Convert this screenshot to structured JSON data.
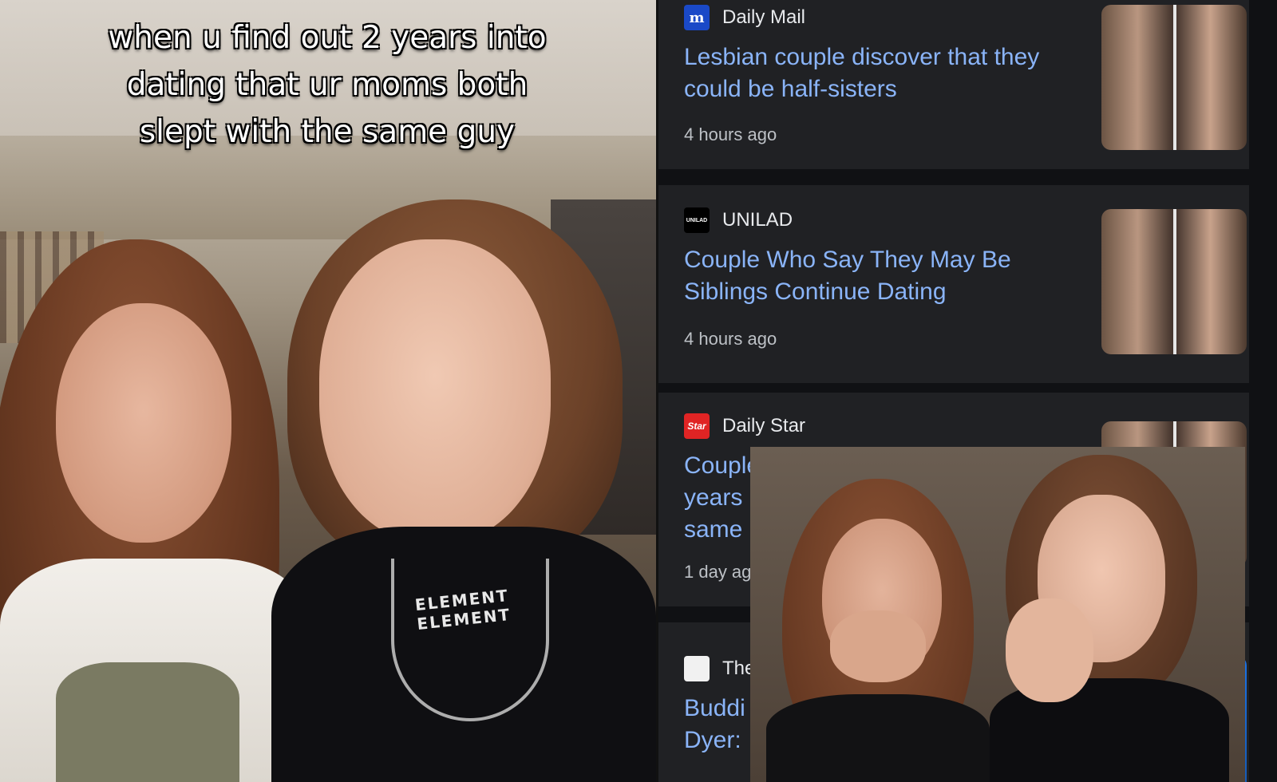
{
  "caption": {
    "text": "when u find out 2 years into dating that ur moms both slept with the same guy"
  },
  "collar_text": "ELEMENT ELEMENT",
  "news": [
    {
      "source": "Daily Mail",
      "logo_text": "m",
      "logo_color": "#1a49c7",
      "headline": "Lesbian couple discover that they could be half-sisters",
      "time": "4 hours ago"
    },
    {
      "source": "UNILAD",
      "logo_text": "UNILAD",
      "logo_color": "#000000",
      "headline": "Couple Who Say They May Be Siblings Continue Dating",
      "time": "4 hours ago"
    },
    {
      "source": "Daily Star",
      "logo_text": "Star",
      "logo_color": "#e02424",
      "headline": "Couple who have been dating for 2 years believe they might share same dad",
      "time": "1 day ago"
    },
    {
      "source": "The M",
      "logo_text": "",
      "logo_color": "#f1f1f1",
      "headline": "Buddi Dyer:",
      "time": ""
    }
  ],
  "colors": {
    "headline": "#8ab4f8",
    "card_bg": "#202124",
    "panel_bg": "#101114"
  }
}
